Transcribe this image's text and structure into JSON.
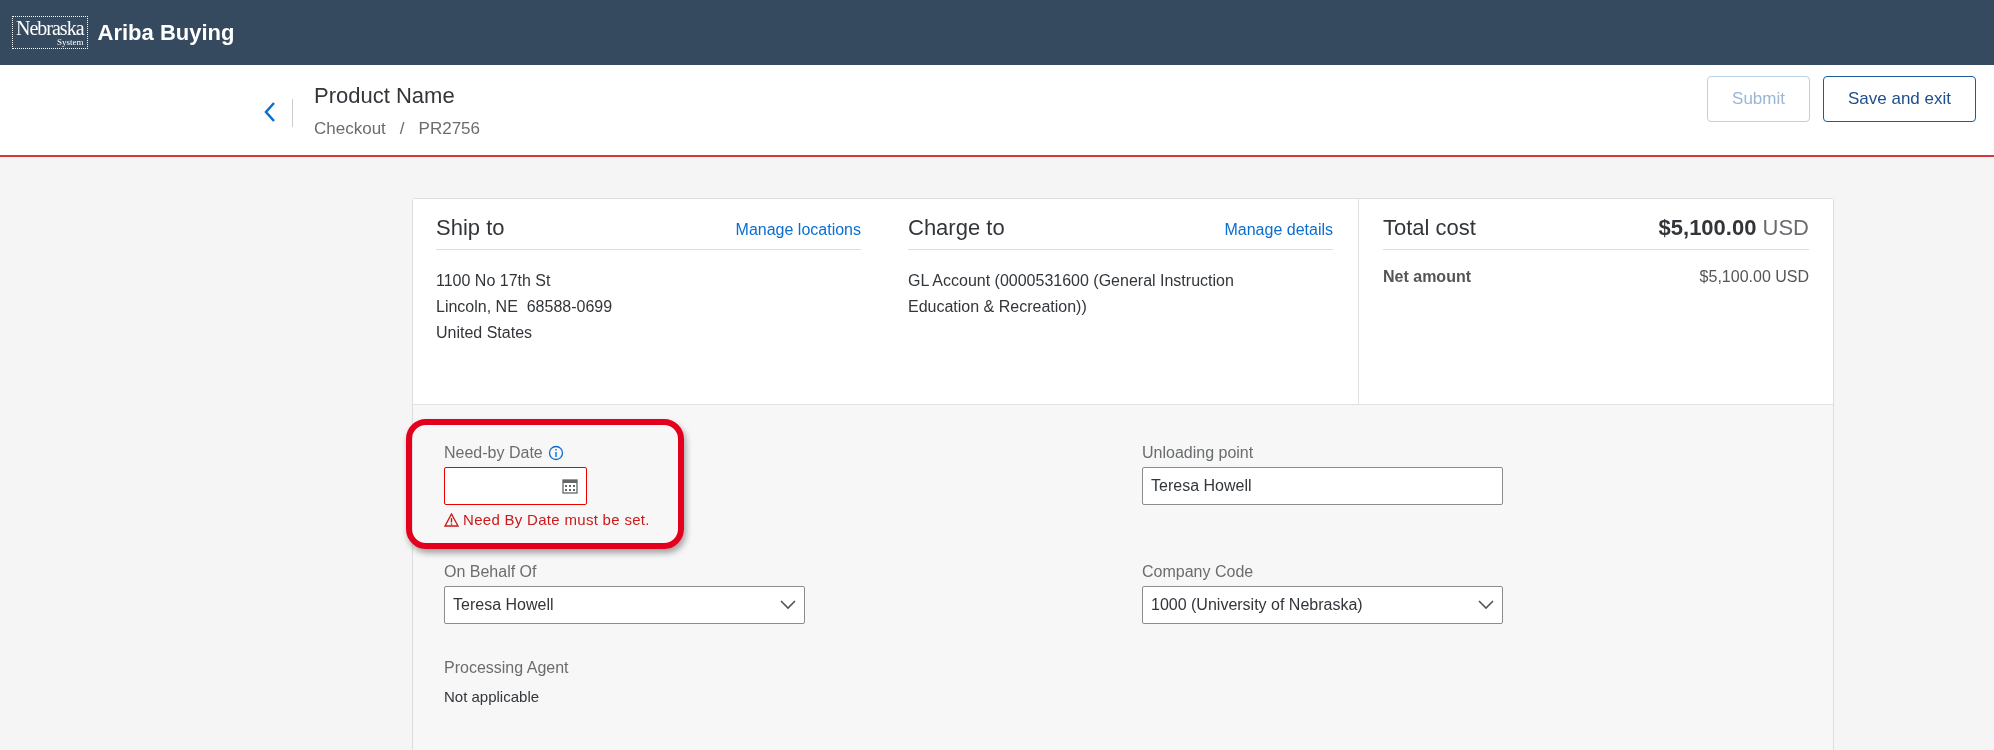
{
  "header": {
    "logo_text": "Nebraska",
    "logo_subtext": "System",
    "app_title": "Ariba Buying"
  },
  "page": {
    "title": "Product Name",
    "breadcrumb": [
      "Checkout",
      "PR2756"
    ],
    "separator": "/"
  },
  "actions": [
    {
      "label": "Submit",
      "disabled": true
    },
    {
      "label": "Save and exit",
      "disabled": false
    }
  ],
  "summary": [
    {
      "heading": "Ship to",
      "link": "Manage locations",
      "lines": [
        "1100 No 17th St",
        "Lincoln, NE  68588-0699",
        "United States"
      ]
    },
    {
      "heading": "Charge to",
      "link": "Manage details",
      "lines": [
        "GL Account (0000531600 (General Instruction",
        "Education & Recreation))"
      ]
    }
  ],
  "total": {
    "heading": "Total cost",
    "amount": "$5,100.00",
    "currency": "USD",
    "rows": [
      {
        "label": "Net amount",
        "value": "$5,100.00 USD"
      }
    ]
  },
  "fields": [
    {
      "kind": "date",
      "label": "Need-by Date",
      "info": true,
      "error": "Need By Date must be set.",
      "highlighted": true
    },
    {
      "kind": "text",
      "label": "Unloading point",
      "value": "Teresa Howell",
      "info": false,
      "highlighted": false
    },
    {
      "kind": "select",
      "label": "On Behalf Of",
      "value": "Teresa Howell",
      "info": false,
      "highlighted": false
    },
    {
      "kind": "select",
      "label": "Company Code",
      "value": "1000 (University of Nebraska)",
      "info": false,
      "highlighted": false
    },
    {
      "kind": "readonly",
      "label": "Processing Agent",
      "value": "Not applicable",
      "info": false,
      "highlighted": false
    }
  ]
}
